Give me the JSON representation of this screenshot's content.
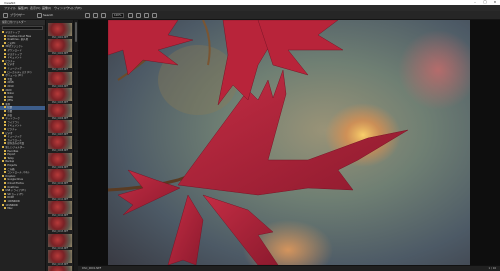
{
  "window": {
    "title": "ViewNX"
  },
  "menu": [
    "ファイル",
    "編集(E)",
    "表示(V)",
    "画像(I)",
    "ウィンドウ",
    "ヘルプ(H)"
  ],
  "toolbar": {
    "browser_label": "ブラウザー",
    "search_label": "Search",
    "zoom_value": "100%"
  },
  "left_pane": {
    "header": "撮影日付/フォルダー",
    "tree": [
      "デスクトップ",
      "Creative Cloud Files",
      "OneDrive - 個人用",
      "このPC",
      "3Dオブジェクト",
      "ダウンロード",
      "デスクトップ",
      "ドキュメント",
      "ピクチャ",
      "ビデオ",
      "ミュージック",
      "ローカルディスク (C:)",
      "ボリューム (D:)",
      "写真",
      "2018",
      "2019",
      "2020",
      "Nikon",
      "RAW",
      "JPEG",
      "風景",
      "紅葉",
      "京都",
      "奈良",
      "ネットワーク",
      "ライブラリ",
      "ドキュメント",
      "ピクチャ",
      "ビデオ",
      "ミュージック",
      "カメラロール",
      "保存済みの写真",
      "新しいフォルダー",
      "Favorites",
      "Export",
      "Temp",
      "Backup",
      "Projects",
      "ごみ箱",
      "コントロール パネル",
      "Dropbox",
      "Google Drive",
      "iCloud Photos",
      "OneDrive",
      "USB ドライブ (E:)",
      "SD カード (F:)",
      "DCIM",
      "100NIKON",
      "101NIKON",
      "Misc"
    ],
    "selected_index": 21
  },
  "thumbnails": [
    "DSC_0001.NEF",
    "DSC_0002.NEF",
    "DSC_0003.NEF",
    "DSC_0004.NEF",
    "DSC_0005.NEF",
    "DSC_0006.NEF",
    "DSC_0007.NEF",
    "DSC_0008.NEF",
    "DSC_0009.NEF",
    "DSC_0010.NEF",
    "DSC_0011.NEF",
    "DSC_0012.NEF",
    "DSC_0013.NEF",
    "DSC_0014.NEF",
    "DSC_0015.NEF",
    "DSC_0016.NEF"
  ],
  "status": {
    "left": "DSC_0001.NEF",
    "right": "1 / 16"
  },
  "colors": {
    "leaf": "#b8243a",
    "selection": "#3d5d8a"
  }
}
